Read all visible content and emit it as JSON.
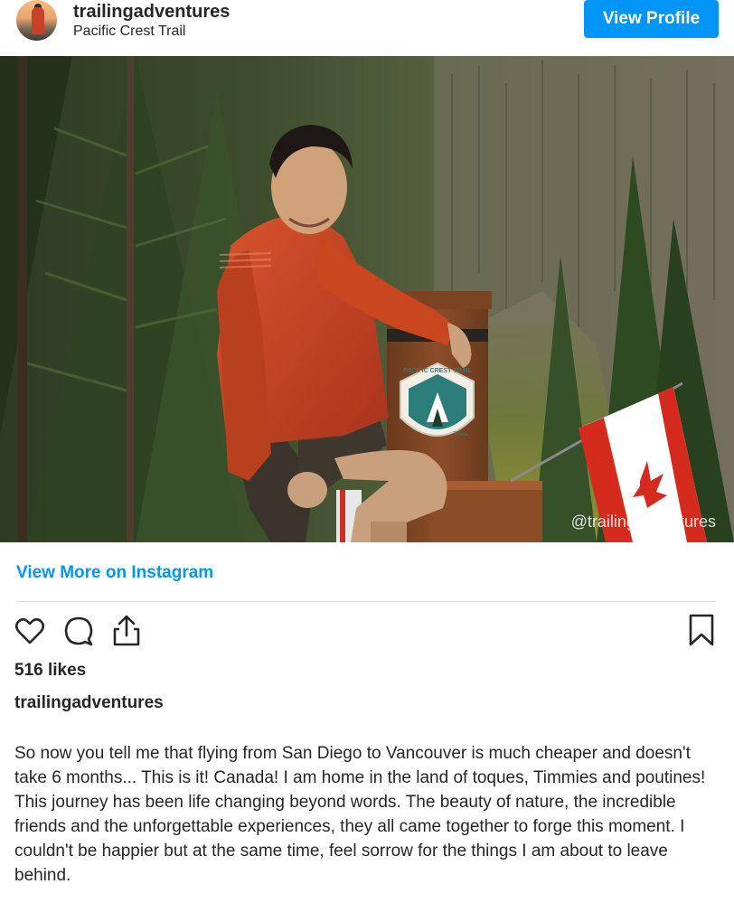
{
  "header": {
    "username": "trailingadventures",
    "location": "Pacific Crest Trail",
    "view_profile_label": "View Profile"
  },
  "photo": {
    "watermark": "@trailingadventures",
    "sign_text_top": "PACIFIC CREST TRAIL",
    "sign_text_bottom": "TRAIL"
  },
  "links": {
    "view_more": "View More on Instagram"
  },
  "actions": {
    "like_icon": "heart-icon",
    "comment_icon": "comment-icon",
    "share_icon": "share-icon",
    "save_icon": "bookmark-icon"
  },
  "post": {
    "likes": "516 likes",
    "caption_username": "trailingadventures",
    "caption_text": "So now you tell me that flying from San Diego to Vancouver is much cheaper and doesn't take 6 months... This is it! Canada! I am home in the land of toques, Timmies and poutines! This journey has been life changing beyond words. The beauty of nature, the incredible friends and the unforgettable experiences, they all came together to forge this moment. I couldn't be happier but at the same time, feel sorrow for the things I am about to leave behind."
  },
  "colors": {
    "accent": "#0095f6",
    "text": "#262626",
    "divider": "#dbdbdb"
  }
}
